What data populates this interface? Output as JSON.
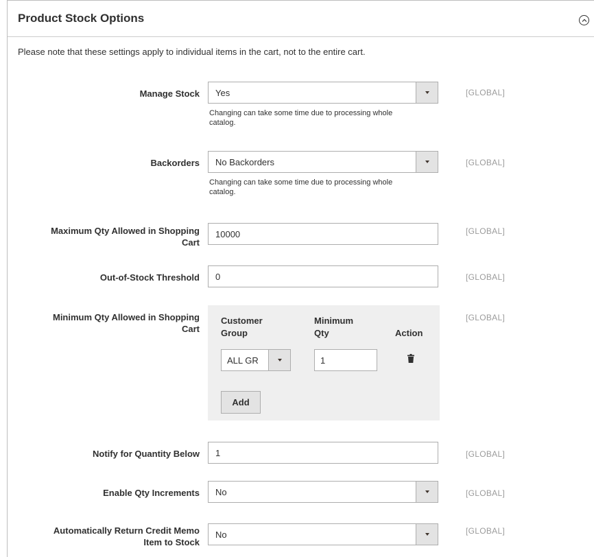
{
  "section": {
    "title": "Product Stock Options",
    "note": "Please note that these settings apply to individual items in the cart, not to the entire cart."
  },
  "scope_label": "[GLOBAL]",
  "manage_stock": {
    "label": "Manage Stock",
    "value": "Yes",
    "hint_line1": "Changing can take some time due to processing whole",
    "hint_line2": "catalog."
  },
  "backorders": {
    "label": "Backorders",
    "value": "No Backorders",
    "hint_line1": "Changing can take some time due to processing whole",
    "hint_line2": "catalog."
  },
  "max_qty": {
    "label_line1": "Maximum Qty Allowed in Shopping",
    "label_line2": "Cart",
    "value": "10000"
  },
  "out_of_stock": {
    "label": "Out-of-Stock Threshold",
    "value": "0"
  },
  "min_qty": {
    "label_line1": "Minimum Qty Allowed in Shopping",
    "label_line2": "Cart",
    "columns": {
      "group_line1": "Customer",
      "group_line2": "Group",
      "min_line1": "Minimum",
      "min_line2": "Qty",
      "action": "Action"
    },
    "rows": [
      {
        "group": "ALL GR",
        "qty": "1"
      }
    ],
    "add_label": "Add"
  },
  "notify_below": {
    "label": "Notify for Quantity Below",
    "value": "1"
  },
  "qty_increments": {
    "label": "Enable Qty Increments",
    "value": "No"
  },
  "credit_memo": {
    "label_line1": "Automatically Return Credit Memo",
    "label_line2": "Item to Stock",
    "value": "No"
  },
  "icons": {
    "collapse": "chevron-up-circle-icon",
    "dropdown": "caret-down-icon",
    "delete": "trash-icon"
  }
}
